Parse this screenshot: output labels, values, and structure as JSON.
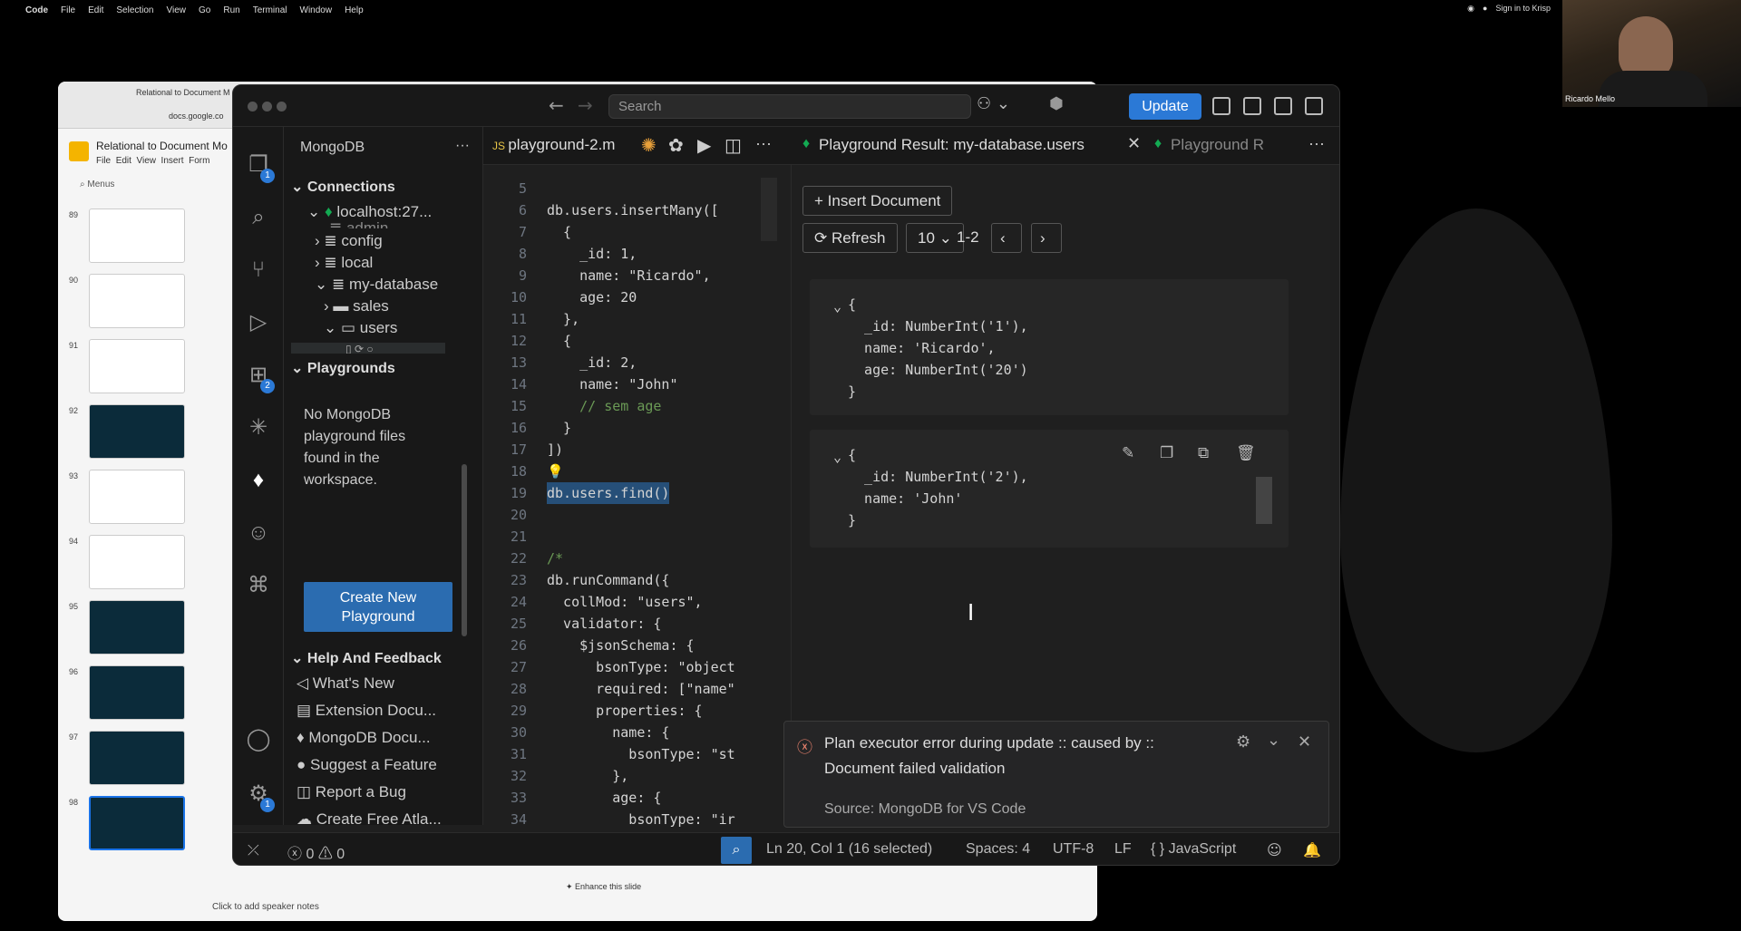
{
  "menubar": {
    "app": "Code",
    "items": [
      "File",
      "Edit",
      "Selection",
      "View",
      "Go",
      "Run",
      "Terminal",
      "Window",
      "Help"
    ],
    "krisp": "Sign in to Krisp"
  },
  "webcam": {
    "name": "Ricardo Mello"
  },
  "slides": {
    "tab_title": "Relational to Document M",
    "url": "docs.google.co",
    "doc_title": "Relational to Document Mo",
    "menus": [
      "File",
      "Edit",
      "View",
      "Insert",
      "Form"
    ],
    "menus_search": "Menus",
    "slide_numbers": [
      "89",
      "90",
      "91",
      "92",
      "93",
      "94",
      "95",
      "96",
      "97",
      "98"
    ],
    "speaker_notes": "Click to add speaker notes",
    "enhance": "Enhance this slide"
  },
  "vscode": {
    "search_placeholder": "Search",
    "update_label": "Update",
    "activity_badges": {
      "explorer": "1",
      "extensions": "2",
      "settings": "1"
    },
    "sidebar": {
      "title": "MongoDB",
      "connections_label": "Connections",
      "connection": "localhost:27...",
      "tree": [
        {
          "label": "admin"
        },
        {
          "label": "config"
        },
        {
          "label": "local"
        },
        {
          "label": "my-database"
        },
        {
          "label": "sales"
        },
        {
          "label": "users"
        }
      ],
      "playgrounds_label": "Playgrounds",
      "no_playground_text": "No MongoDB playground files found in the workspace.",
      "create_button": "Create New Playground",
      "help_label": "Help And Feedback",
      "help_items": [
        "What's New",
        "Extension Docu...",
        "MongoDB Docu...",
        "Suggest a Feature",
        "Report a Bug",
        "Create Free Atla..."
      ]
    },
    "editor": {
      "tab_label": "playground-2.m",
      "lines": [
        {
          "n": "5",
          "code": ""
        },
        {
          "n": "6",
          "code": "db.users.insertMany(["
        },
        {
          "n": "7",
          "code": "  {"
        },
        {
          "n": "8",
          "code": "    _id: 1,"
        },
        {
          "n": "9",
          "code": "    name: \"Ricardo\","
        },
        {
          "n": "10",
          "code": "    age: 20"
        },
        {
          "n": "11",
          "code": "  },"
        },
        {
          "n": "12",
          "code": "  {"
        },
        {
          "n": "13",
          "code": "    _id: 2,"
        },
        {
          "n": "14",
          "code": "    name: \"John\""
        },
        {
          "n": "15",
          "code": "    // sem age"
        },
        {
          "n": "16",
          "code": "  }"
        },
        {
          "n": "17",
          "code": "])"
        },
        {
          "n": "18",
          "code": ""
        },
        {
          "n": "19",
          "code": "db.users.find()"
        },
        {
          "n": "20",
          "code": ""
        },
        {
          "n": "21",
          "code": ""
        },
        {
          "n": "22",
          "code": "/*"
        },
        {
          "n": "23",
          "code": "db.runCommand({"
        },
        {
          "n": "24",
          "code": "  collMod: \"users\","
        },
        {
          "n": "25",
          "code": "  validator: {"
        },
        {
          "n": "26",
          "code": "    $jsonSchema: {"
        },
        {
          "n": "27",
          "code": "      bsonType: \"object"
        },
        {
          "n": "28",
          "code": "      required: [\"name\""
        },
        {
          "n": "29",
          "code": "      properties: {"
        },
        {
          "n": "30",
          "code": "        name: {"
        },
        {
          "n": "31",
          "code": "          bsonType: \"st"
        },
        {
          "n": "32",
          "code": "        },"
        },
        {
          "n": "33",
          "code": "        age: {"
        },
        {
          "n": "34",
          "code": "          bsonType: \"ir"
        }
      ]
    },
    "result": {
      "tab_label": "Playground Result: my-database.users",
      "tab2_label": "Playground R",
      "insert_label": "Insert Document",
      "refresh_label": "Refresh",
      "page_size": "10",
      "range": "1-2",
      "documents": [
        {
          "lines": [
            "{",
            "  _id: NumberInt('1'),",
            "  name: 'Ricardo',",
            "  age: NumberInt('20')",
            "}"
          ]
        },
        {
          "lines": [
            "{",
            "  _id: NumberInt('2'),",
            "  name: 'John'",
            "}"
          ]
        }
      ]
    },
    "notification": {
      "message_1": "Plan executor error during update :: caused by ::",
      "message_2": "Document failed validation",
      "source": "Source: MongoDB for VS Code"
    },
    "status": {
      "errors": "0",
      "warnings": "0",
      "cursor": "Ln 20, Col 1 (16 selected)",
      "spaces": "Spaces: 4",
      "encoding": "UTF-8",
      "eol": "LF",
      "language": "JavaScript"
    }
  }
}
